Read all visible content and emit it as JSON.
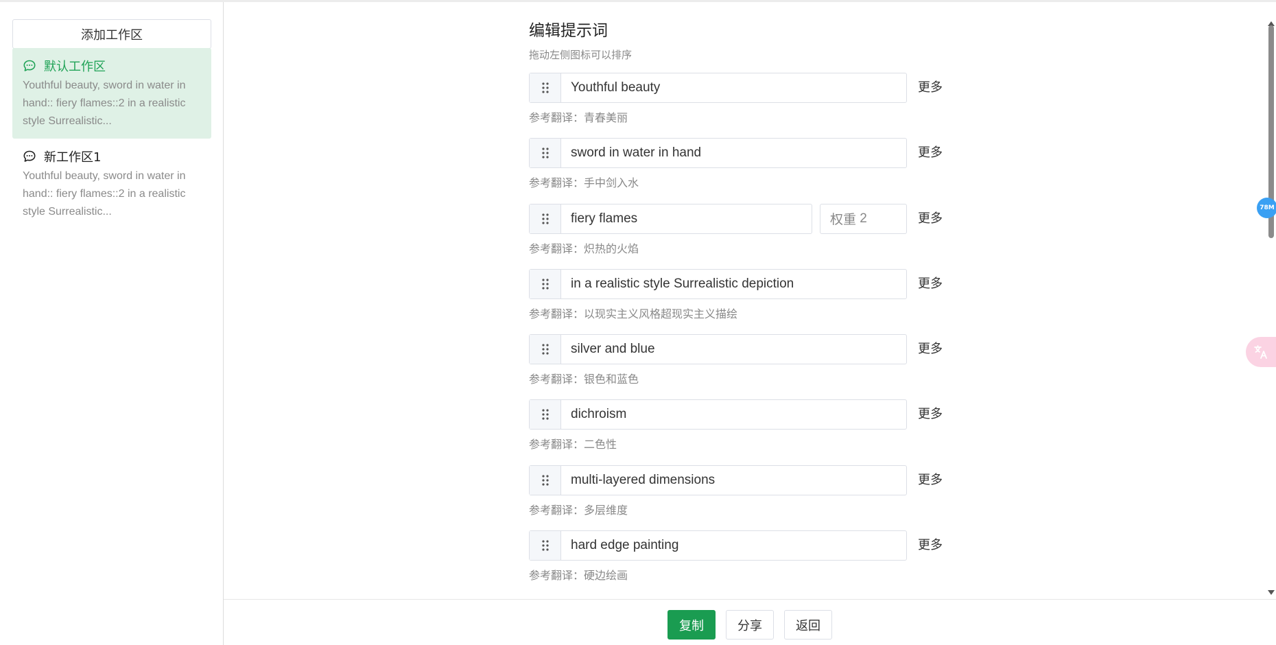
{
  "sidebar": {
    "add_button": "添加工作区",
    "workspaces": [
      {
        "name": "默认工作区",
        "preview": "Youthful beauty, sword in water in hand:: fiery flames::2 in a realistic style Surrealistic...",
        "active": true
      },
      {
        "name": "新工作区1",
        "preview": "Youthful beauty, sword in water in hand:: fiery flames::2 in a realistic style Surrealistic...",
        "active": false
      }
    ]
  },
  "editor": {
    "title": "编辑提示词",
    "subtitle": "拖动左侧图标可以排序",
    "more_label": "更多",
    "ref_prefix": "参考翻译：",
    "weight_prefix": "权重",
    "prompts": [
      {
        "text": "Youthful beauty",
        "translation": "青春美丽"
      },
      {
        "text": "sword in water in hand",
        "translation": "手中剑入水"
      },
      {
        "text": "fiery flames",
        "translation": "炽热的火焰",
        "weight": "2"
      },
      {
        "text": "in a realistic style Surrealistic depiction",
        "translation": "以现实主义风格超现实主义描绘"
      },
      {
        "text": "silver and blue",
        "translation": "银色和蓝色"
      },
      {
        "text": "dichroism",
        "translation": "二色性"
      },
      {
        "text": "multi-layered dimensions",
        "translation": "多层维度"
      },
      {
        "text": "hard edge painting",
        "translation": "硬边绘画"
      }
    ]
  },
  "footer": {
    "copy": "复制",
    "share": "分享",
    "back": "返回"
  },
  "overlay": {
    "memory_badge": "78M",
    "translate_icon": "translate-icon"
  },
  "colors": {
    "accent": "#1a9c51",
    "active_bg": "#dff1e6",
    "active_text": "#20a357",
    "badge": "#3aa0f3"
  }
}
